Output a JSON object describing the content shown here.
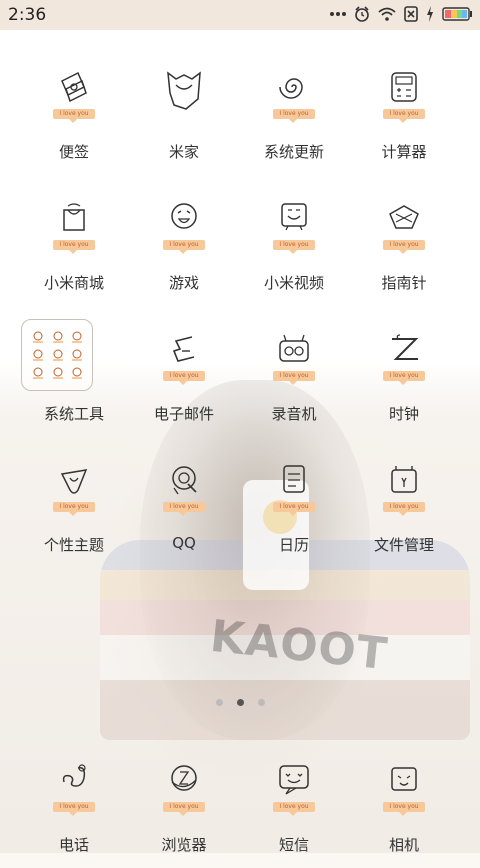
{
  "status_bar": {
    "time": "2:36",
    "icons": [
      "more-icon",
      "alarm-icon",
      "wifi-icon",
      "sim-off-icon",
      "charging-icon",
      "battery-icon"
    ]
  },
  "apps": [
    {
      "label": "便签",
      "icon": "notes-icon",
      "tag": "I love you"
    },
    {
      "label": "米家",
      "icon": "mijia-icon",
      "tag": ""
    },
    {
      "label": "系统更新",
      "icon": "update-icon",
      "tag": "I love you"
    },
    {
      "label": "计算器",
      "icon": "calculator-icon",
      "tag": "I love you"
    },
    {
      "label": "小米商城",
      "icon": "mistore-icon",
      "tag": "I love you"
    },
    {
      "label": "游戏",
      "icon": "game-icon",
      "tag": "I love you"
    },
    {
      "label": "小米视频",
      "icon": "video-icon",
      "tag": "I love you"
    },
    {
      "label": "指南针",
      "icon": "compass-icon",
      "tag": "I love you"
    },
    {
      "label": "系统工具",
      "icon": "folder-icon",
      "tag": ""
    },
    {
      "label": "电子邮件",
      "icon": "email-icon",
      "tag": "I love you"
    },
    {
      "label": "录音机",
      "icon": "recorder-icon",
      "tag": "I love you"
    },
    {
      "label": "时钟",
      "icon": "clock-icon",
      "tag": "I love you"
    },
    {
      "label": "个性主题",
      "icon": "themes-icon",
      "tag": "I love you"
    },
    {
      "label": "QQ",
      "icon": "qq-icon",
      "tag": "I love you"
    },
    {
      "label": "日历",
      "icon": "calendar-icon",
      "tag": "I love you"
    },
    {
      "label": "文件管理",
      "icon": "files-icon",
      "tag": "I love you"
    }
  ],
  "dock": [
    {
      "label": "电话",
      "icon": "phone-icon",
      "tag": "I love you"
    },
    {
      "label": "浏览器",
      "icon": "browser-icon",
      "tag": "I love you"
    },
    {
      "label": "短信",
      "icon": "messages-icon",
      "tag": "I love you"
    },
    {
      "label": "相机",
      "icon": "camera-icon",
      "tag": "I love you"
    }
  ],
  "wallpaper_text": "KAOOT",
  "page_indicator": {
    "pages": 3,
    "active": 2
  },
  "colors": {
    "status_bar_bg": "#f1e7dc",
    "tag_bg": "#f7c89a",
    "tag_text": "#c0622a",
    "battery": [
      "#f06a6a",
      "#f8c65a",
      "#7fd67f",
      "#6ab8f0"
    ]
  }
}
